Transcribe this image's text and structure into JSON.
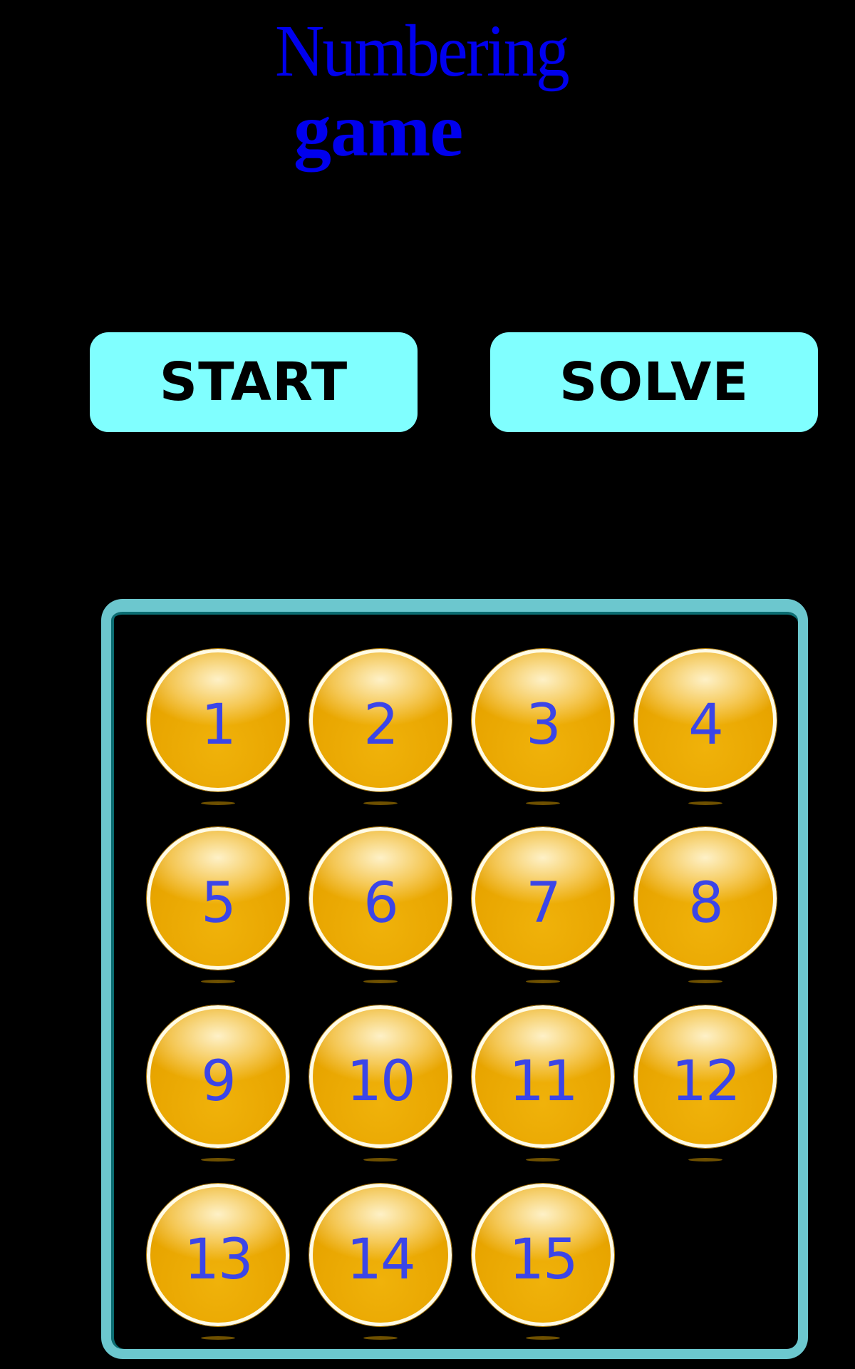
{
  "title": {
    "line1": "Numbering",
    "line2": "game"
  },
  "buttons": {
    "start": "START",
    "solve": "SOLVE"
  },
  "board": {
    "rows": 4,
    "cols": 4,
    "tiles": [
      "1",
      "2",
      "3",
      "4",
      "5",
      "6",
      "7",
      "8",
      "9",
      "10",
      "11",
      "12",
      "13",
      "14",
      "15",
      ""
    ]
  },
  "colors": {
    "background": "#000000",
    "title": "#0000ee",
    "button": "#80ffff",
    "board_border": "#6cc7ce",
    "tile": "#e8a500",
    "tile_number": "#3b45e8"
  }
}
